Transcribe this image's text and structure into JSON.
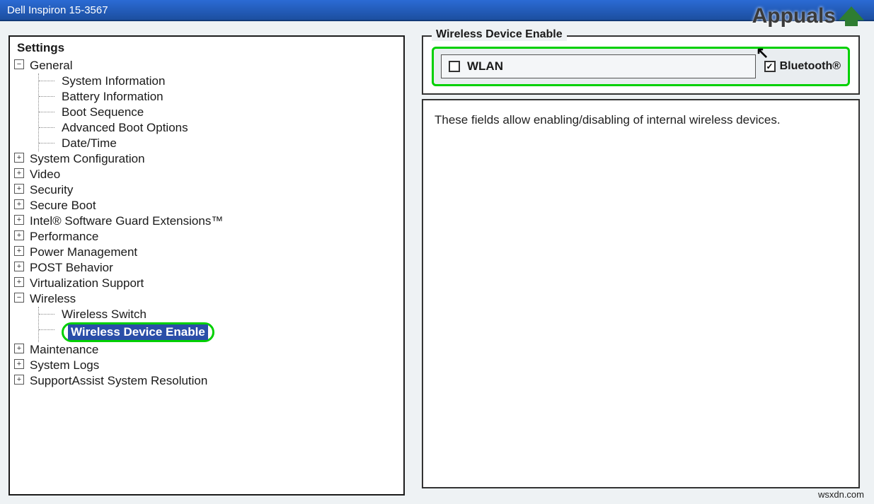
{
  "window": {
    "title": "Dell Inspiron 15-3567"
  },
  "left": {
    "caption": "Settings",
    "selected_path": "Wireless > Wireless Device Enable",
    "nodes": [
      {
        "label": "General",
        "expanded": true,
        "children": [
          "System Information",
          "Battery Information",
          "Boot Sequence",
          "Advanced Boot Options",
          "Date/Time"
        ]
      },
      {
        "label": "System Configuration",
        "expanded": false
      },
      {
        "label": "Video",
        "expanded": false
      },
      {
        "label": "Security",
        "expanded": false
      },
      {
        "label": "Secure Boot",
        "expanded": false
      },
      {
        "label": "Intel® Software Guard Extensions™",
        "expanded": false
      },
      {
        "label": "Performance",
        "expanded": false
      },
      {
        "label": "Power Management",
        "expanded": false
      },
      {
        "label": "POST Behavior",
        "expanded": false
      },
      {
        "label": "Virtualization Support",
        "expanded": false
      },
      {
        "label": "Wireless",
        "expanded": true,
        "children": [
          "Wireless Switch",
          "Wireless Device Enable"
        ]
      },
      {
        "label": "Maintenance",
        "expanded": false
      },
      {
        "label": "System Logs",
        "expanded": false
      },
      {
        "label": "SupportAssist System Resolution",
        "expanded": false
      }
    ]
  },
  "right": {
    "legend": "Wireless Device Enable",
    "wlan": {
      "label": "WLAN",
      "checked": false
    },
    "bluetooth": {
      "label": "Bluetooth®",
      "checked": true
    },
    "description": "These fields allow enabling/disabling of internal wireless devices."
  },
  "brand": {
    "text": "Appuals"
  },
  "watermark": "wsxdn.com",
  "ui": {
    "glyph_plus": "+",
    "glyph_minus": "−",
    "checkmark": "✓"
  }
}
